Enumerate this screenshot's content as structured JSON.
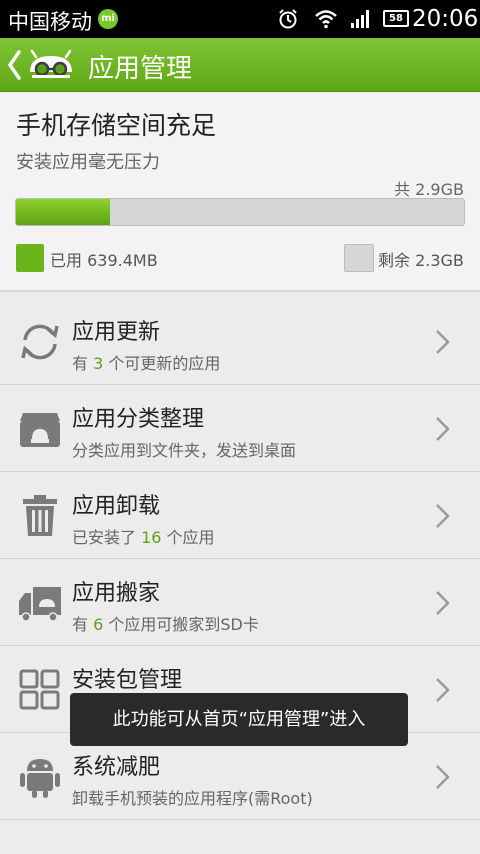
{
  "status_bar": {
    "carrier": "中国移动",
    "notification_icon": "mi-icon",
    "battery": "58",
    "time": "20:06"
  },
  "titlebar": {
    "title": "应用管理"
  },
  "storage": {
    "headline": "手机存储空间充足",
    "subtext": "安装应用毫无压力",
    "total": "共 2.9GB",
    "used_fraction": 0.21,
    "used_label": "已用 639.4MB",
    "free_label": "剩余 2.3GB",
    "colors": {
      "used": "#6bb51b",
      "free": "#d6d6d6"
    }
  },
  "items": [
    {
      "label": "应用更新",
      "desc_pre": "有 ",
      "desc_num": "3",
      "desc_post": " 个可更新的应用",
      "icon": "refresh-icon"
    },
    {
      "label": "应用分类整理",
      "desc_pre": "分类应用到文件夹，发送到桌面",
      "desc_num": "",
      "desc_post": "",
      "icon": "folder-box-icon"
    },
    {
      "label": "应用卸载",
      "desc_pre": "已安装了 ",
      "desc_num": "16",
      "desc_post": " 个应用",
      "icon": "trash-icon"
    },
    {
      "label": "应用搬家",
      "desc_pre": "有 ",
      "desc_num": "6",
      "desc_post": " 个应用可搬家到SD卡",
      "icon": "truck-icon"
    },
    {
      "label": "安装包管理",
      "desc_pre": "",
      "desc_num": "",
      "desc_post": "",
      "icon": "grid-icon"
    },
    {
      "label": "系统减肥",
      "desc_pre": "卸载手机预装的应用程序(需Root)",
      "desc_num": "",
      "desc_post": "",
      "icon": "android-icon"
    }
  ],
  "toast": "此功能可从首页“应用管理”进入",
  "accent": "#6bb51b"
}
